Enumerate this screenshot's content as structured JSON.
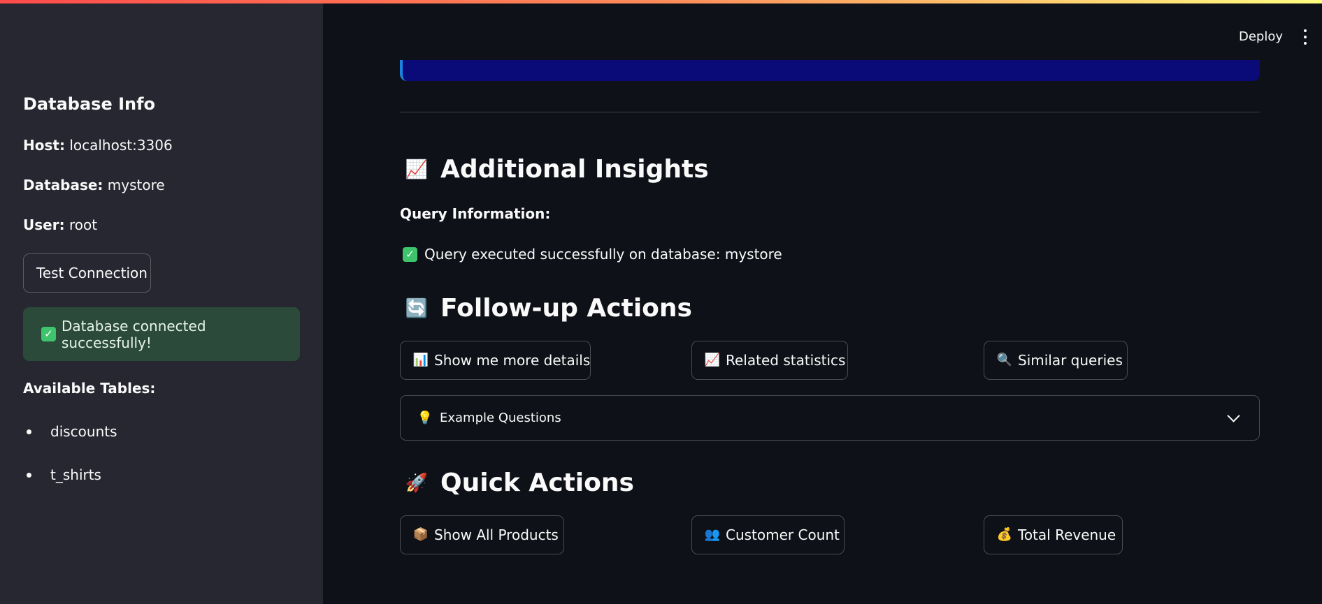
{
  "header": {
    "deploy_label": "Deploy",
    "menu_icon": "more-vertical-icon"
  },
  "sidebar": {
    "title": "Database Info",
    "host_label": "Host:",
    "host_value": "localhost:3306",
    "database_label": "Database:",
    "database_value": "mystore",
    "user_label": "User:",
    "user_value": "root",
    "test_button": "Test Connection",
    "success_message": "Database connected successfully!",
    "tables_title": "Available Tables:",
    "tables": [
      "discounts",
      "t_shirts"
    ]
  },
  "main": {
    "insights": {
      "icon": "📈",
      "title": "Additional Insights",
      "query_info_label": "Query Information:",
      "query_message": "Query executed successfully on database: mystore"
    },
    "followup": {
      "icon": "🔄",
      "title": "Follow-up Actions",
      "buttons": [
        {
          "icon": "📊",
          "label": "Show me more details"
        },
        {
          "icon": "📈",
          "label": "Related statistics"
        },
        {
          "icon": "🔍",
          "label": "Similar queries"
        }
      ],
      "expander": {
        "icon": "💡",
        "label": "Example Questions"
      }
    },
    "quick": {
      "icon": "🚀",
      "title": "Quick Actions",
      "buttons": [
        {
          "icon": "📦",
          "label": "Show All Products"
        },
        {
          "icon": "👥",
          "label": "Customer Count"
        },
        {
          "icon": "💰",
          "label": "Total Revenue"
        }
      ]
    }
  },
  "colors": {
    "background": "#0e1117",
    "sidebar": "#262730",
    "success_bg": "#2b4a3a",
    "info_bar": "#0a0a78"
  }
}
